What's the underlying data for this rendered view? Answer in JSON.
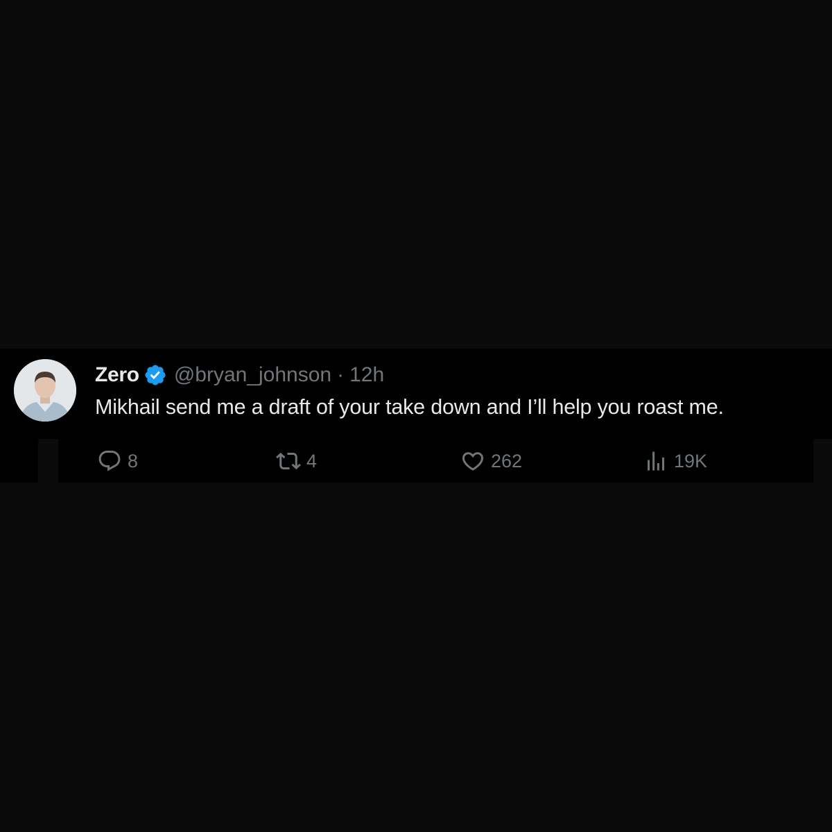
{
  "tweet": {
    "author": {
      "display_name": "Zero",
      "verified": true,
      "handle": "@bryan_johnson",
      "separator": "·",
      "time": "12h"
    },
    "text": "Mikhail send me a draft of your take down and I’ll help you roast me.",
    "actions": {
      "replies": "8",
      "reposts": "4",
      "likes": "262",
      "views": "19K"
    }
  },
  "colors": {
    "background": "#0a0a0a",
    "card": "#000000",
    "primary_text": "#e7e9ea",
    "secondary_text": "#71767b",
    "verified_blue": "#1d9bf0"
  },
  "icons": {
    "avatar": "avatar",
    "verified": "verified-badge-icon",
    "reply": "reply-bubble-icon",
    "repost": "repost-icon",
    "like": "heart-icon",
    "views": "bar-chart-icon"
  }
}
